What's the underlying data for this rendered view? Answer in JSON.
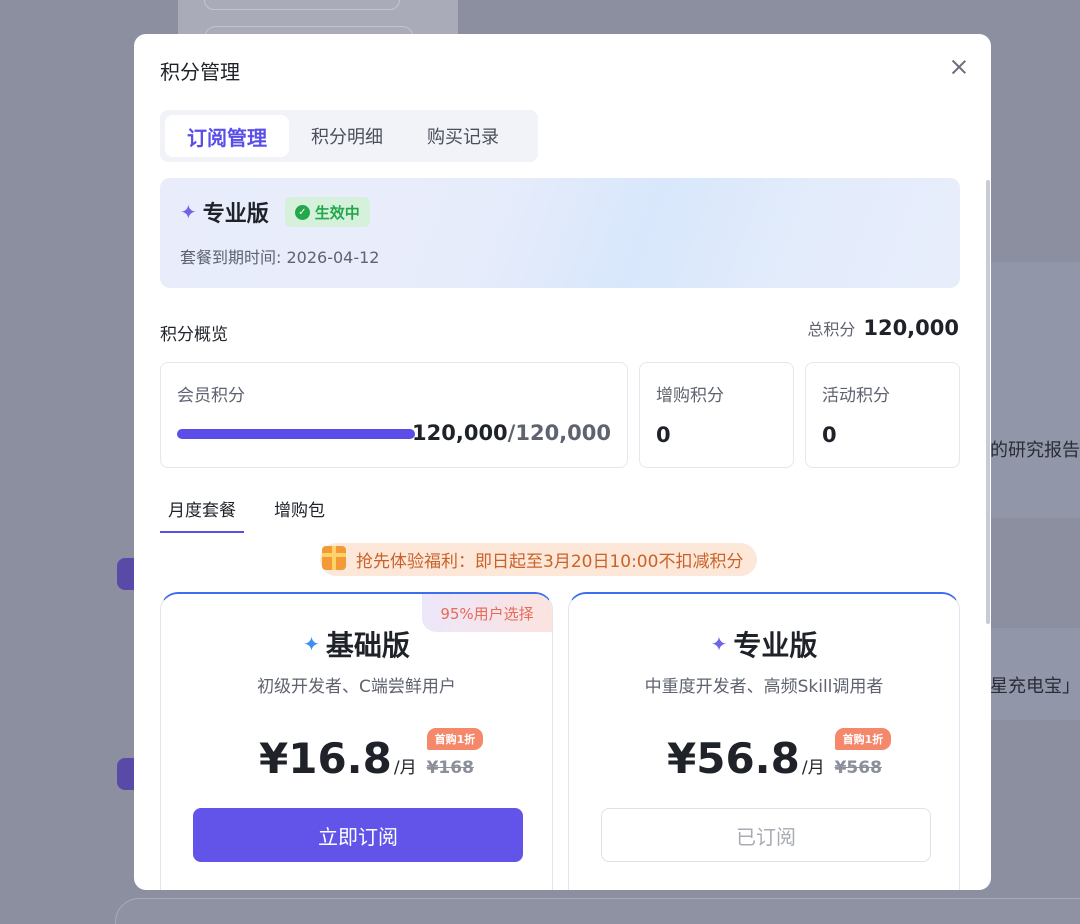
{
  "background": {
    "text_research": "的研究报告",
    "text_power": "星充电宝」的"
  },
  "modal": {
    "title": "积分管理",
    "tabs": [
      {
        "label": "订阅管理",
        "active": true
      },
      {
        "label": "积分明细",
        "active": false
      },
      {
        "label": "购买记录",
        "active": false
      }
    ],
    "current_plan": {
      "name": "专业版",
      "status": "生效中",
      "expire_text": "套餐到期时间: 2026-04-12"
    },
    "overview": {
      "label": "积分概览",
      "total_label": "总积分",
      "total_value": "120,000",
      "member": {
        "label": "会员积分",
        "value": "120,000",
        "max": "/120,000",
        "progress": 1.0
      },
      "addon": {
        "label": "增购积分",
        "value": "0"
      },
      "activity": {
        "label": "活动积分",
        "value": "0"
      }
    },
    "sub_tabs": [
      {
        "label": "月度套餐",
        "active": true
      },
      {
        "label": "增购包",
        "active": false
      }
    ],
    "promo_text": "抢先体验福利：即日起至3月20日10:00不扣减积分",
    "plans": [
      {
        "name": "基础版",
        "subtitle": "初级开发者、C端尝鲜用户",
        "price": "¥16.8",
        "per": "/月",
        "original": "¥168",
        "discount_tag": "首购1折",
        "badge": "95%用户选择",
        "button": "立即订阅"
      },
      {
        "name": "专业版",
        "subtitle": "中重度开发者、高频Skill调用者",
        "price": "¥56.8",
        "per": "/月",
        "original": "¥568",
        "discount_tag": "首购1折",
        "button": "已订阅"
      }
    ]
  },
  "colors": {
    "accent": "#5b4ee8",
    "status_green": "#22a84a",
    "promo_orange": "#c9622a",
    "card_top_border": "#3c6ff0"
  }
}
